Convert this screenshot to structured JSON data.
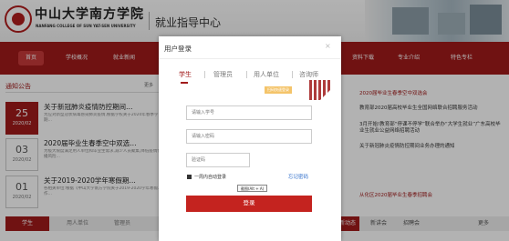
{
  "header": {
    "school_cn": "中山大学南方学院",
    "school_en": "NANFANG COLLEGE OF SUN YAT-SEN UNIVERSITY",
    "site_title": "就业指导中心"
  },
  "nav": {
    "items": [
      "首页",
      "学校概况",
      "就业新闻",
      "资料下载",
      "专业介绍",
      "特色专栏"
    ]
  },
  "left": {
    "section_title": "通知公告",
    "more": "更多",
    "news": [
      {
        "day": "25",
        "ym": "2020/02",
        "title": "关于新冠肺炎疫情防控期间…",
        "summary": "为应对新型冠状病毒感染肺炎疫情,根据学校关于2020年春季学期…"
      },
      {
        "day": "03",
        "ym": "2020/02",
        "title": "2020届毕业生春季空中双选…",
        "summary": "为极大限度满足用人单位和毕业生需求,减少人员聚集,降低疫情传播风险…"
      },
      {
        "day": "01",
        "ym": "2020/02",
        "title": "关于2019-2020学年寒假期…",
        "summary": "各相关单位:根据《中山大学南方学院关于2019-2020学年寒假工作…"
      }
    ],
    "tabs": [
      "学生",
      "用人单位",
      "管理员"
    ]
  },
  "right": {
    "items": [
      "2020届毕业生春季空中双选会",
      "教育部2020届高校毕业生全国网络联合招聘服务活动",
      "3月开始!教育部“停课不停学”联合举办“大学生就业”广东高校毕业生就业公益网络招聘活动",
      "关于新冠肺炎疫情防控期间业务办理的通知",
      "从化区2020届毕业生春季招聘会"
    ],
    "tabs": [
      "最新动态",
      "新讲会",
      "招聘会",
      "更多"
    ]
  },
  "modal": {
    "title": "用户登录",
    "close": "×",
    "tabs": [
      "学生",
      "管理员",
      "用人单位",
      "咨询师"
    ],
    "qr_tip": "扫码快速登录",
    "student_id_placeholder": "请输入学号",
    "password_placeholder": "请输入密码",
    "captcha_placeholder": "验证码",
    "remember_label": "一周内自动登录",
    "forgot": "忘记密码",
    "screenshot_tip": "截图(Alt + A)",
    "login_button": "登录"
  },
  "colors": {
    "brand": "#a11a1a",
    "login_button": "#c4231f",
    "link": "#2a6ac9"
  }
}
